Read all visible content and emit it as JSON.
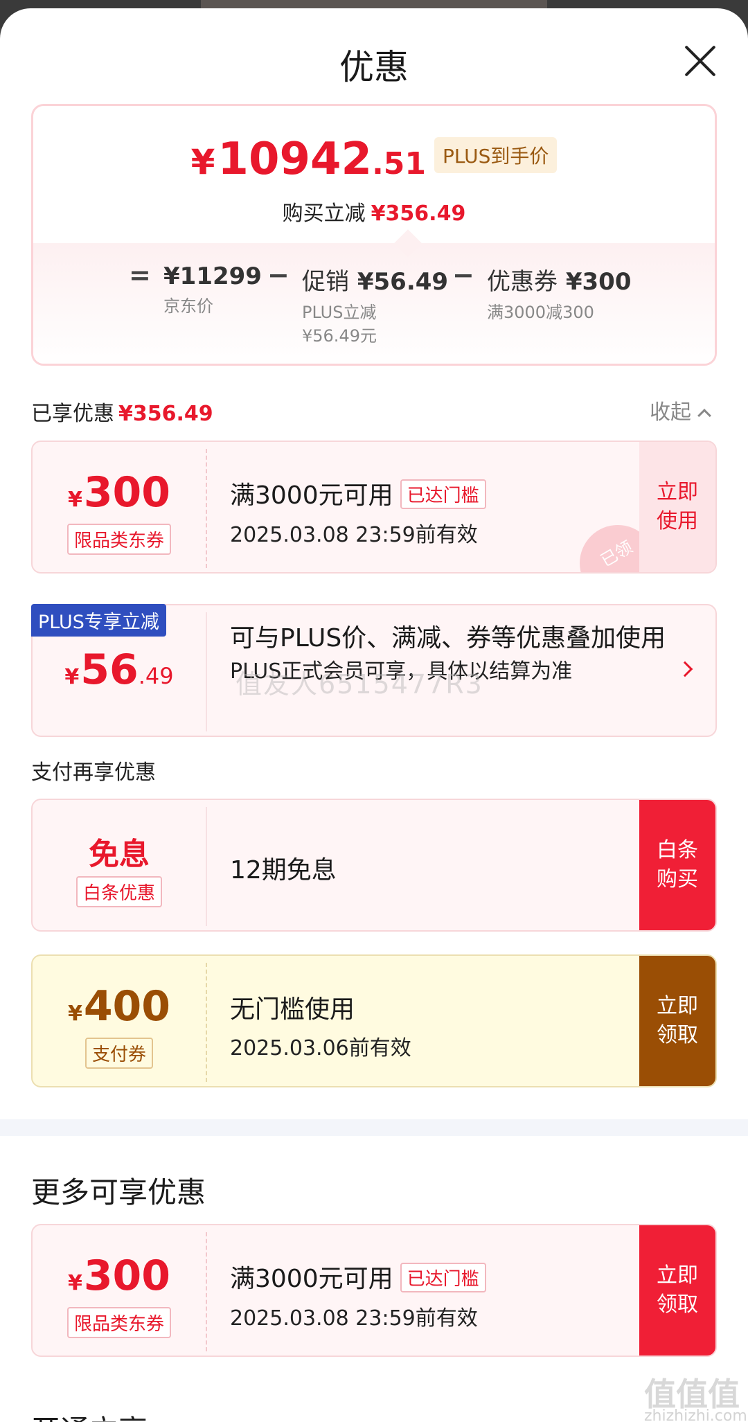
{
  "sheet": {
    "title": "优惠"
  },
  "price": {
    "yen": "¥",
    "main": "10942",
    "cents": ".51",
    "plus_tag": "PLUS到手价",
    "buy_less_label": "购买立减",
    "buy_less_value": "¥356.49",
    "eq": "=",
    "minus": "−",
    "jd_value": "¥11299",
    "jd_label": "京东价",
    "promo_label": "促销",
    "promo_value": "¥56.49",
    "promo_sub1": "PLUS立减",
    "promo_sub2": "¥56.49元",
    "coupon_label": "优惠券",
    "coupon_value": "¥300",
    "coupon_sub": "满3000减300"
  },
  "enjoyed": {
    "label": "已享优惠",
    "value": "¥356.49",
    "collapse": "收起"
  },
  "coupon1": {
    "yen": "¥",
    "amount": "300",
    "kind": "限品类东券",
    "line1": "满3000元可用",
    "tag": "已达门槛",
    "line2": "2025.03.08 23:59前有效",
    "action1": "立即",
    "action2": "使用",
    "stamp": "已领"
  },
  "plus_card": {
    "badge": "PLUS专享立减",
    "yen": "¥",
    "amount": "56",
    "cents": ".49",
    "line1": "可与PLUS价、满减、券等优惠叠加使用",
    "line2": "PLUS正式会员可享，具体以结算为准",
    "watermark": "值友人6515477R3"
  },
  "pay": {
    "title": "支付再享优惠",
    "baitiao": {
      "amount": "免息",
      "kind": "白条优惠",
      "line1": "12期免息",
      "action1": "白条",
      "action2": "购买"
    },
    "paycoupon": {
      "yen": "¥",
      "amount": "400",
      "kind": "支付券",
      "line1": "无门槛使用",
      "line2": "2025.03.06前有效",
      "action1": "立即",
      "action2": "领取"
    }
  },
  "more": {
    "title": "更多可享优惠",
    "coupon": {
      "yen": "¥",
      "amount": "300",
      "kind": "限品类东券",
      "line1": "满3000元可用",
      "tag": "已达门槛",
      "line2": "2025.03.08 23:59前有效",
      "action1": "立即",
      "action2": "领取"
    }
  },
  "next_section": {
    "title": "开通立享"
  },
  "site": {
    "mark": "值值值",
    "url": "zhizhizhi.com"
  },
  "colors": {
    "accent_red": "#e8182c",
    "plus_blue": "#2f4ebf",
    "brown": "#9a4e05",
    "cream": "#fffbe0"
  }
}
